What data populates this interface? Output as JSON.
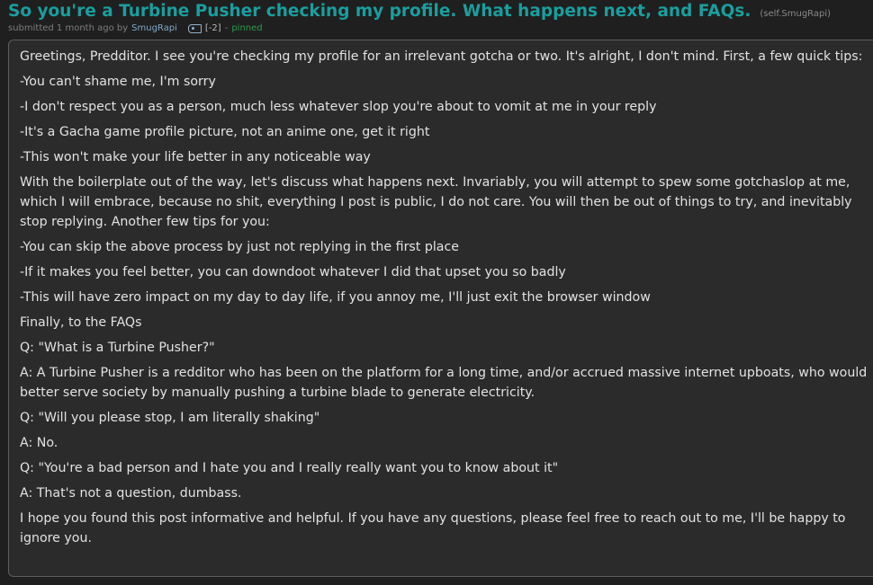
{
  "post": {
    "title": "So you're a Turbine Pusher checking my profile. What happens next, and FAQs.",
    "domain": "(self.SmugRapi)",
    "tagline": {
      "submitted": "submitted 1 month ago by",
      "author": "SmugRapi",
      "flair_icon": "user-flair-icon",
      "score": "[-2]",
      "separator": "-",
      "pinned": "pinned"
    },
    "paragraphs": [
      "Greetings, Predditor. I see you're checking my profile for an irrelevant gotcha or two. It's alright, I don't mind. First, a few quick tips:",
      "-You can't shame me, I'm sorry",
      "-I don't respect you as a person, much less whatever slop you're about to vomit at me in your reply",
      "-It's a Gacha game profile picture, not an anime one, get it right",
      "-This won't make your life better in any noticeable way",
      "With the boilerplate out of the way, let's discuss what happens next. Invariably, you will attempt to spew some gotchaslop at me, which I will embrace, because no shit, everything I post is public, I do not care. You will then be out of things to try, and inevitably stop replying. Another few tips for you:",
      "-You can skip the above process by just not replying in the first place",
      "-If it makes you feel better, you can downdoot whatever I did that upset you so badly",
      "-This will have zero impact on my day to day life, if you annoy me, I'll just exit the browser window",
      "Finally, to the FAQs",
      "Q: \"What is a Turbine Pusher?\"",
      "A: A Turbine Pusher is a redditor who has been on the platform for a long time, and/or accrued massive internet upboats, who would better serve society by manually pushing a turbine blade to generate electricity.",
      "Q: \"Will you please stop, I am literally shaking\"",
      "A: No.",
      "Q: \"You're a bad person and I hate you and I really really want you to know about it\"",
      "A: That's not a question, dumbass.",
      "I hope you found this post informative and helpful. If you have any questions, please feel free to reach out to me, I'll be happy to ignore you."
    ]
  },
  "colors": {
    "background": "#1f1f1f",
    "title": "#1a9e9e",
    "body_bg": "#2b2b2b",
    "body_text": "#e2e2e2",
    "pinned": "#2e9a4d"
  }
}
